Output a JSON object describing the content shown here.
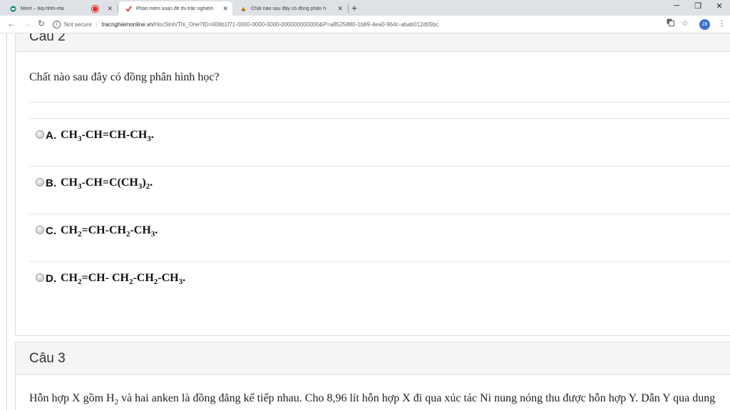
{
  "tabs": [
    {
      "title": "Meet – tkq-hhfn-eta",
      "icon": "google-meet-icon"
    },
    {
      "title": "Phần mềm soạn đề thi trắc nghiệm",
      "icon": "tracnghiem-logo-icon"
    },
    {
      "title": "Chất nào sau đây có đồng phân h",
      "icon": "hoc247-logo-icon"
    }
  ],
  "address": {
    "security": "Not secure",
    "domain": "tracnghiemonline.vn",
    "path": "/HocSinh/Thi_One?ID=006b1f71-0000-0000-0000-000000000000&P=a8525880-1b89-4ea0-964c-abab012d05bc"
  },
  "profile": {
    "badge": "28"
  },
  "q2": {
    "heading": "Câu 2",
    "question": "Chất nào sau đây có đồng phân hình học?",
    "options": [
      {
        "letter": "A.",
        "parts": [
          "CH",
          "3",
          "-CH=CH-CH",
          "3",
          "."
        ]
      },
      {
        "letter": "B.",
        "parts": [
          "CH",
          "3",
          "-CH=C(CH",
          "3",
          ")",
          "2",
          "."
        ]
      },
      {
        "letter": "C.",
        "parts": [
          "CH",
          "2",
          "=CH-CH",
          "2",
          "-CH",
          "3",
          "."
        ]
      },
      {
        "letter": "D.",
        "parts": [
          "CH",
          "2",
          "=CH- CH",
          "2",
          "-CH",
          "2",
          "-CH",
          "3",
          "."
        ]
      }
    ]
  },
  "q3": {
    "heading": "Câu 3",
    "text_before": "Hỗn hợp X gồm H",
    "text_sub": "2",
    "text_after": " và hai anken là đồng đẳng kế tiếp nhau. Cho 8,96 lít hỗn hợp X đi qua xúc tác Ni nung nóng thu được hỗn hợp Y. Dẫn Y qua dung"
  }
}
